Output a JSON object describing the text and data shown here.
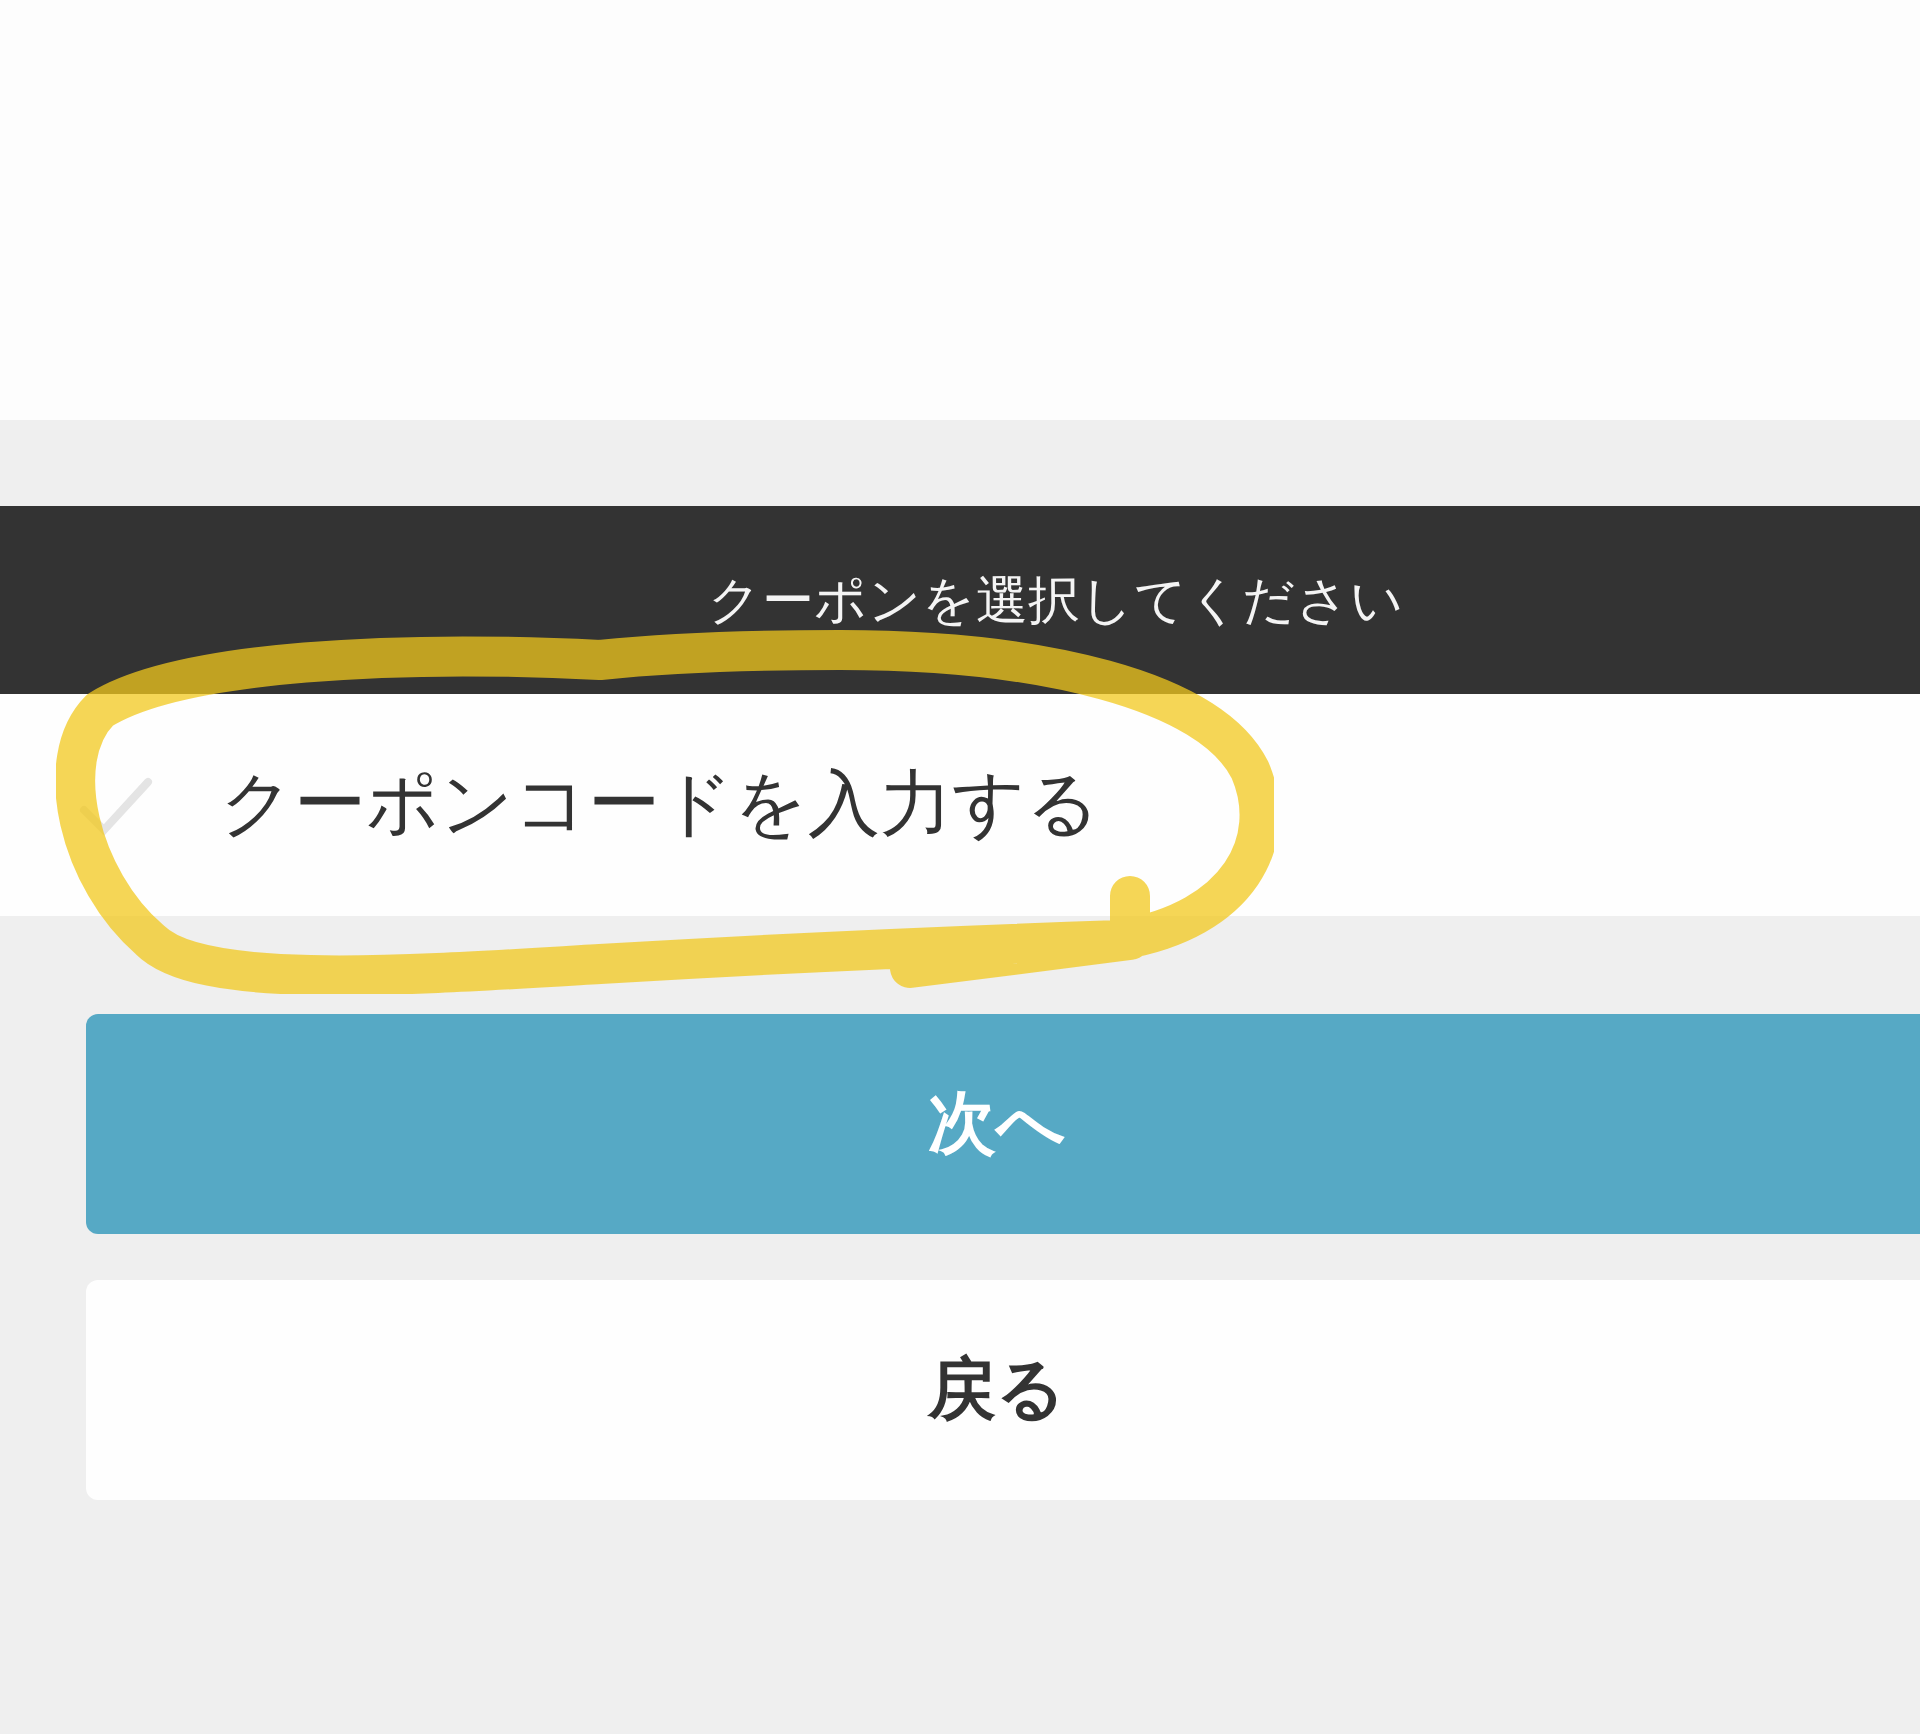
{
  "header": {
    "title": "クーポンを選択してください"
  },
  "options": [
    {
      "label": "クーポンコードを入力する",
      "checked": false
    }
  ],
  "buttons": [
    {
      "label": "次へ",
      "kind": "primary"
    },
    {
      "label": "戻る",
      "kind": "secondary"
    }
  ],
  "annotation": {
    "kind": "highlight"
  }
}
